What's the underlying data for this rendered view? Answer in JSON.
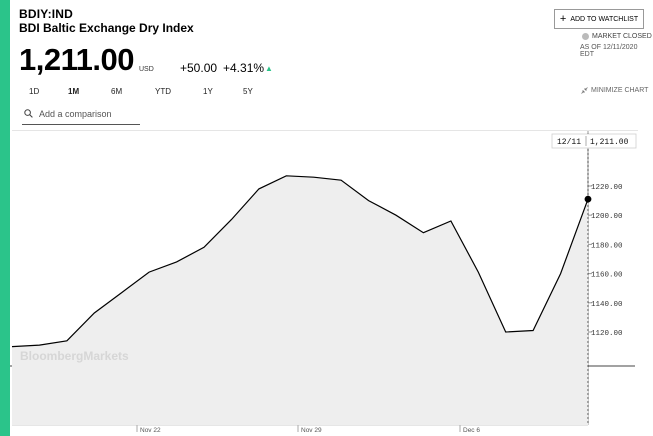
{
  "header": {
    "ticker": "BDIY:IND",
    "name": "BDI Baltic Exchange Dry Index",
    "price": "1,211.00",
    "currency": "USD",
    "change": "+50.00",
    "change_pct": "+4.31%",
    "watchlist_label": "ADD TO WATCHLIST",
    "market_status": "MARKET CLOSED",
    "as_of": "AS OF 12/11/2020 EDT"
  },
  "colors": {
    "accent": "#2bc48a",
    "line": "#000000",
    "area": "#eeeeee"
  },
  "ranges": {
    "tabs": [
      {
        "label": "1D",
        "active": false
      },
      {
        "label": "1M",
        "active": true
      },
      {
        "label": "6M",
        "active": false
      },
      {
        "label": "YTD",
        "active": false
      },
      {
        "label": "1Y",
        "active": false
      },
      {
        "label": "5Y",
        "active": false
      }
    ],
    "minimize_label": "MINIMIZE CHART"
  },
  "comparison": {
    "placeholder": "Add a comparison"
  },
  "tooltip": {
    "date": "12/11",
    "value": "1,211.00"
  },
  "watermark": "BloombergMarkets",
  "chart_data": {
    "type": "area",
    "x": [
      "2020-11-11",
      "2020-11-12",
      "2020-11-13",
      "2020-11-16",
      "2020-11-17",
      "2020-11-18",
      "2020-11-19",
      "2020-11-20",
      "2020-11-23",
      "2020-11-24",
      "2020-11-25",
      "2020-11-26",
      "2020-11-27",
      "2020-11-30",
      "2020-12-01",
      "2020-12-02",
      "2020-12-03",
      "2020-12-04",
      "2020-12-07",
      "2020-12-08",
      "2020-12-09",
      "2020-12-10",
      "2020-12-11"
    ],
    "values": [
      1110,
      1111,
      1114,
      1133,
      1147,
      1161,
      1168,
      1178,
      1197,
      1218,
      1227,
      1226,
      1224,
      1210,
      1200,
      1188,
      1196,
      1161,
      1120,
      1121,
      1160,
      1211
    ],
    "ylim": [
      1100,
      1235
    ],
    "yticks": [
      1120,
      1140,
      1160,
      1180,
      1200,
      1220
    ],
    "ytick_labels": [
      "1120.00",
      "1140.00",
      "1160.00",
      "1180.00",
      "1200.00",
      "1220.00"
    ],
    "xtick_labels": [
      "Nov 22",
      "Nov 29",
      "Dec 6"
    ],
    "grid": false,
    "title": "",
    "xlabel": "",
    "ylabel": ""
  }
}
